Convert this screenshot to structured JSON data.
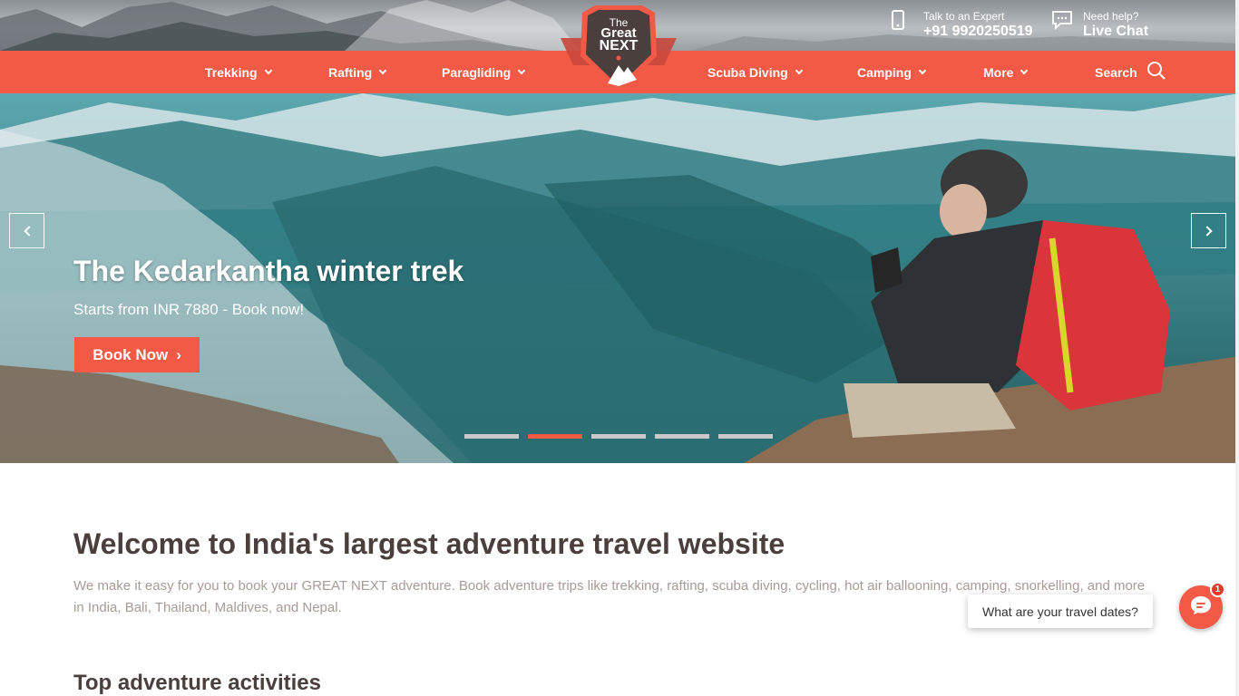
{
  "brand": {
    "logo_line1": "The",
    "logo_line2": "Great",
    "logo_line3": "NEXT",
    "accent_color": "#f25a45"
  },
  "header": {
    "expert": {
      "label": "Talk to an Expert",
      "value": "+91 9920250519",
      "icon": "phone-icon"
    },
    "help": {
      "label": "Need help?",
      "value": "Live Chat",
      "icon": "chat-icon"
    }
  },
  "nav": {
    "items": [
      {
        "label": "Trekking"
      },
      {
        "label": "Rafting"
      },
      {
        "label": "Paragliding"
      },
      {
        "label": "Scuba Diving"
      },
      {
        "label": "Camping"
      },
      {
        "label": "More"
      }
    ],
    "search_label": "Search"
  },
  "hero": {
    "title": "The Kedarkantha winter trek",
    "subtitle": "Starts from INR 7880 - Book now!",
    "button": "Book Now",
    "slides_total": 5,
    "active_slide": 2
  },
  "content": {
    "welcome_title": "Welcome to India's largest adventure travel website",
    "intro": "We make it easy for you to book your GREAT NEXT adventure. Book adventure trips like trekking, rafting, scuba diving, cycling, hot air ballooning, camping, snorkelling, and more in India, Bali, Thailand, Maldives, and Nepal.",
    "section_title": "Top adventure activities"
  },
  "chat": {
    "prompt": "What are your travel dates?",
    "badge": "1"
  }
}
